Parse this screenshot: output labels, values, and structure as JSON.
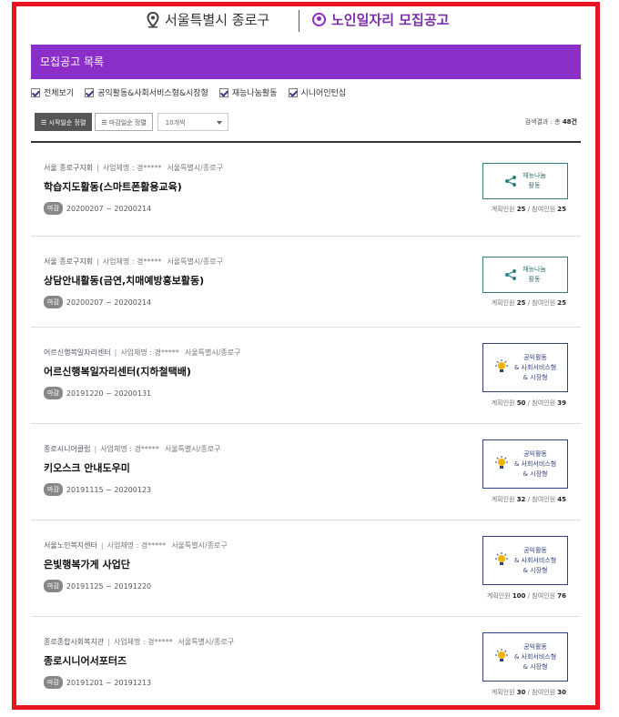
{
  "header": {
    "location": "서울특별시 종로구",
    "page_title": "노인일자리 모집공고"
  },
  "banner": {
    "title": "모집공고 목록"
  },
  "filters": [
    {
      "label": "전체보기",
      "checked": true
    },
    {
      "label": "공익활동&사회서비스형&시장형",
      "checked": true
    },
    {
      "label": "재능나눔활동",
      "checked": true
    },
    {
      "label": "시니어인턴십",
      "checked": true
    }
  ],
  "sort": {
    "start_date": "시작일순 정렬",
    "end_date": "마감일순 정렬",
    "page_size": "10개씩"
  },
  "total": {
    "label": "검색결과 : 총",
    "count": "48건"
  },
  "listing": [
    {
      "org": "서울 종로구지회",
      "operator_label": "사업체명 : 경*****",
      "address": "서울특별시/종로구",
      "title": "학습지도활동(스마트폰활용교육)",
      "badge": "마감",
      "period": "20200207 ~ 20200214",
      "category_lines": [
        "재능나눔",
        "활동"
      ],
      "planned_label": "계획인원",
      "planned": "25",
      "participant_label": "참여인원",
      "participants": "25",
      "icon": "share-icon"
    },
    {
      "org": "서울 종로구지회",
      "operator_label": "사업체명 : 경*****",
      "address": "서울특별시/종로구",
      "title": "상담안내활동(금연,치매예방홍보활동)",
      "badge": "마감",
      "period": "20200207 ~ 20200214",
      "category_lines": [
        "재능나눔",
        "활동"
      ],
      "planned_label": "계획인원",
      "planned": "25",
      "participant_label": "참여인원",
      "participants": "25",
      "icon": "share-icon"
    },
    {
      "org": "어르신행복일자리센터",
      "operator_label": "사업체명 : 경*****",
      "address": "서울특별시/종로구",
      "title": "어르신행복일자리센터(지하철택배)",
      "badge": "마감",
      "period": "20191220 ~ 20200131",
      "category_lines": [
        "공익활동",
        "& 사회서비스형",
        "& 시장형"
      ],
      "planned_label": "계획인원",
      "planned": "50",
      "participant_label": "참여인원",
      "participants": "39",
      "icon": "lightbulb-icon"
    },
    {
      "org": "종로시니어클럽",
      "operator_label": "사업체명 : 경*****",
      "address": "서울특별시/종로구",
      "title": "키오스크 안내도우미",
      "badge": "마감",
      "period": "20191115 ~ 20200123",
      "category_lines": [
        "공익활동",
        "& 사회서비스형",
        "& 시장형"
      ],
      "planned_label": "계획인원",
      "planned": "32",
      "participant_label": "참여인원",
      "participants": "45",
      "icon": "lightbulb-icon"
    },
    {
      "org": "서울노인복지센터",
      "operator_label": "사업체명 : 경*****",
      "address": "서울특별시/종로구",
      "title": "은빛행복가게 사업단",
      "badge": "마감",
      "period": "20191125 ~ 20191220",
      "category_lines": [
        "공익활동",
        "& 사회서비스형",
        "& 시장형"
      ],
      "planned_label": "계획인원",
      "planned": "100",
      "participant_label": "참여인원",
      "participants": "76",
      "icon": "lightbulb-icon"
    },
    {
      "org": "종로종합사회복지관",
      "operator_label": "사업체명 : 경*****",
      "address": "서울특별시/종로구",
      "title": "종로시니어서포터즈",
      "badge": "마감",
      "period": "20191201 ~ 20191213",
      "category_lines": [
        "공익활동",
        "& 사회서비스형",
        "& 시장형"
      ],
      "planned_label": "계획인원",
      "planned": "30",
      "participant_label": "참여인원",
      "participants": "30",
      "icon": "lightbulb-icon"
    }
  ],
  "colors": {
    "frame": "#e8141f",
    "banner": "#8c2fc9",
    "title": "#7a2ea8",
    "share_category": "#2f7f7f",
    "public_category": "#2f3f7f"
  }
}
